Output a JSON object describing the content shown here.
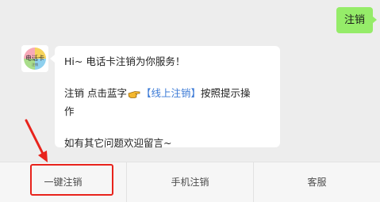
{
  "chat": {
    "user_message": "注销",
    "avatar_text": "电话卡",
    "avatar_subtext": "注销",
    "bot_message": {
      "greeting": "Hi~ 电话卡注销为你服务！",
      "instruction_prefix": "注销 点击蓝字",
      "link_text": "【线上注销】",
      "instruction_suffix_line1": "按照提示操",
      "instruction_suffix_line2": "作",
      "closing": "如有其它问题欢迎留言~"
    }
  },
  "menu": {
    "items": [
      {
        "label": "一键注销"
      },
      {
        "label": "手机注销"
      },
      {
        "label": "客服"
      }
    ]
  },
  "colors": {
    "user_bubble": "#95ec69",
    "link": "#3d7bd6",
    "annotation": "#e8231c"
  }
}
